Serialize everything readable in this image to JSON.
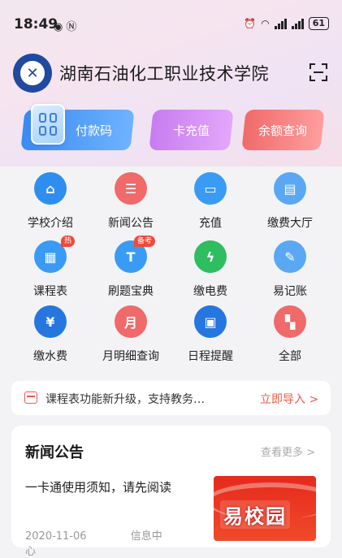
{
  "status": {
    "time": "18:49",
    "battery": "61"
  },
  "header": {
    "school_name": "湖南石油化工职业技术学院"
  },
  "quick_actions": {
    "pay_code": "付款码",
    "card_topup": "卡充值",
    "balance_query": "余额查询"
  },
  "services": [
    {
      "label": "学校介绍",
      "icon": "school-icon",
      "badge": ""
    },
    {
      "label": "新闻公告",
      "icon": "news-icon",
      "badge": ""
    },
    {
      "label": "充值",
      "icon": "card-icon",
      "badge": ""
    },
    {
      "label": "缴费大厅",
      "icon": "payment-hall-icon",
      "badge": ""
    },
    {
      "label": "课程表",
      "icon": "calendar-icon",
      "badge": "热"
    },
    {
      "label": "刷题宝典",
      "icon": "quiz-book-icon",
      "badge": "备考"
    },
    {
      "label": "缴电费",
      "icon": "lightning-icon",
      "badge": ""
    },
    {
      "label": "易记账",
      "icon": "ledger-icon",
      "badge": ""
    },
    {
      "label": "缴水费",
      "icon": "water-drop-icon",
      "badge": ""
    },
    {
      "label": "月明细查询",
      "icon": "monthly-detail-icon",
      "badge": ""
    },
    {
      "label": "日程提醒",
      "icon": "schedule-icon",
      "badge": ""
    },
    {
      "label": "全部",
      "icon": "all-apps-icon",
      "badge": ""
    }
  ],
  "notice": {
    "text": "课程表功能新升级，支持教务…",
    "link": "立即导入 >"
  },
  "news": {
    "title": "新闻公告",
    "more": "查看更多 >",
    "item_title": "一卡通使用须知，请先阅读",
    "item_date": "2020-11-06",
    "item_source": "信息中心",
    "thumb_text": "易校园"
  },
  "colors": {
    "accent_red": "#f05a4a",
    "blue": "#3b8bf3",
    "purple": "#c77cf0"
  }
}
